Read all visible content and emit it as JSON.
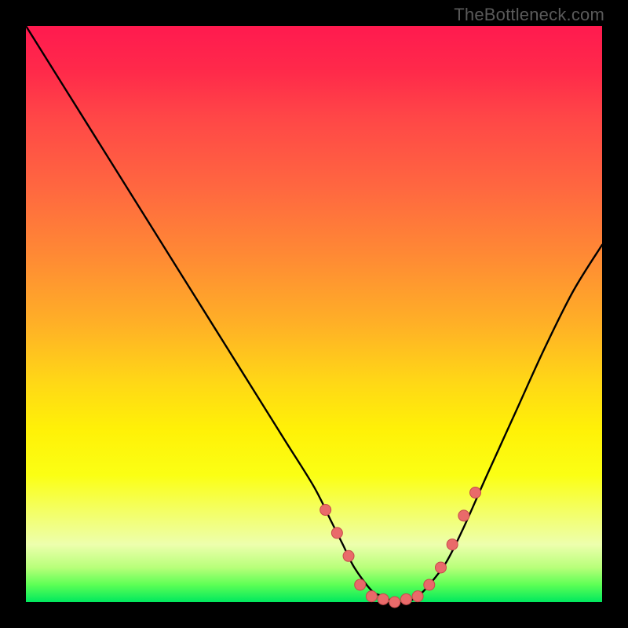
{
  "attribution": "TheBottleneck.com",
  "colors": {
    "background": "#000000",
    "gradient_top": "#ff1a4f",
    "gradient_bottom": "#00e85e",
    "curve_stroke": "#000000",
    "marker_fill": "#e96a6a",
    "marker_stroke": "#c74a4a"
  },
  "chart_data": {
    "type": "line",
    "title": "",
    "xlabel": "",
    "ylabel": "",
    "xlim": [
      0,
      100
    ],
    "ylim": [
      0,
      100
    ],
    "grid": false,
    "legend": false,
    "series": [
      {
        "name": "bottleneck-curve",
        "x": [
          0,
          5,
          10,
          15,
          20,
          25,
          30,
          35,
          40,
          45,
          50,
          53,
          55,
          57,
          60,
          62,
          64,
          66,
          68,
          70,
          73,
          76,
          80,
          85,
          90,
          95,
          100
        ],
        "y": [
          100,
          92,
          84,
          76,
          68,
          60,
          52,
          44,
          36,
          28,
          20,
          14,
          10,
          6,
          2,
          1,
          0,
          0,
          1,
          3,
          7,
          13,
          22,
          33,
          44,
          54,
          62
        ]
      }
    ],
    "markers": {
      "series": "bottleneck-curve",
      "points": [
        {
          "x": 52,
          "y": 16
        },
        {
          "x": 54,
          "y": 12
        },
        {
          "x": 56,
          "y": 8
        },
        {
          "x": 58,
          "y": 3
        },
        {
          "x": 60,
          "y": 1
        },
        {
          "x": 62,
          "y": 0.5
        },
        {
          "x": 64,
          "y": 0
        },
        {
          "x": 66,
          "y": 0.5
        },
        {
          "x": 68,
          "y": 1
        },
        {
          "x": 70,
          "y": 3
        },
        {
          "x": 72,
          "y": 6
        },
        {
          "x": 74,
          "y": 10
        },
        {
          "x": 76,
          "y": 15
        },
        {
          "x": 78,
          "y": 19
        }
      ]
    }
  }
}
